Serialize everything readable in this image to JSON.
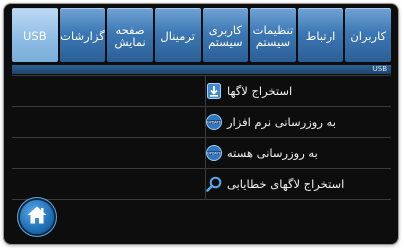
{
  "tabs": [
    {
      "label": "کاربران",
      "active": false
    },
    {
      "label": "ارتباط",
      "active": false
    },
    {
      "label": "تنظیمات\nسیستم",
      "active": false
    },
    {
      "label": "کاربری\nسیستم",
      "active": false
    },
    {
      "label": "ترمینال",
      "active": false
    },
    {
      "label": "صفحه\nنمایش",
      "active": false
    },
    {
      "label": "گزارشات",
      "active": false
    },
    {
      "label": "USB",
      "active": true
    }
  ],
  "section": {
    "label": "USB"
  },
  "items": [
    {
      "label": "استخراج لاگها",
      "icon": "download-icon"
    },
    {
      "label": "به روزرسانی نرم افزار",
      "icon": "update-software-icon"
    },
    {
      "label": "به روزرسانی هسته",
      "icon": "update-kernel-icon"
    },
    {
      "label": "استخراج لاگهای خطایابی",
      "icon": "magnifier-icon"
    }
  ],
  "colors": {
    "accent": "#3c78b4",
    "active_tab": "#8fbde5",
    "background": "#0d0d0d"
  },
  "home": {
    "icon": "home-icon"
  }
}
